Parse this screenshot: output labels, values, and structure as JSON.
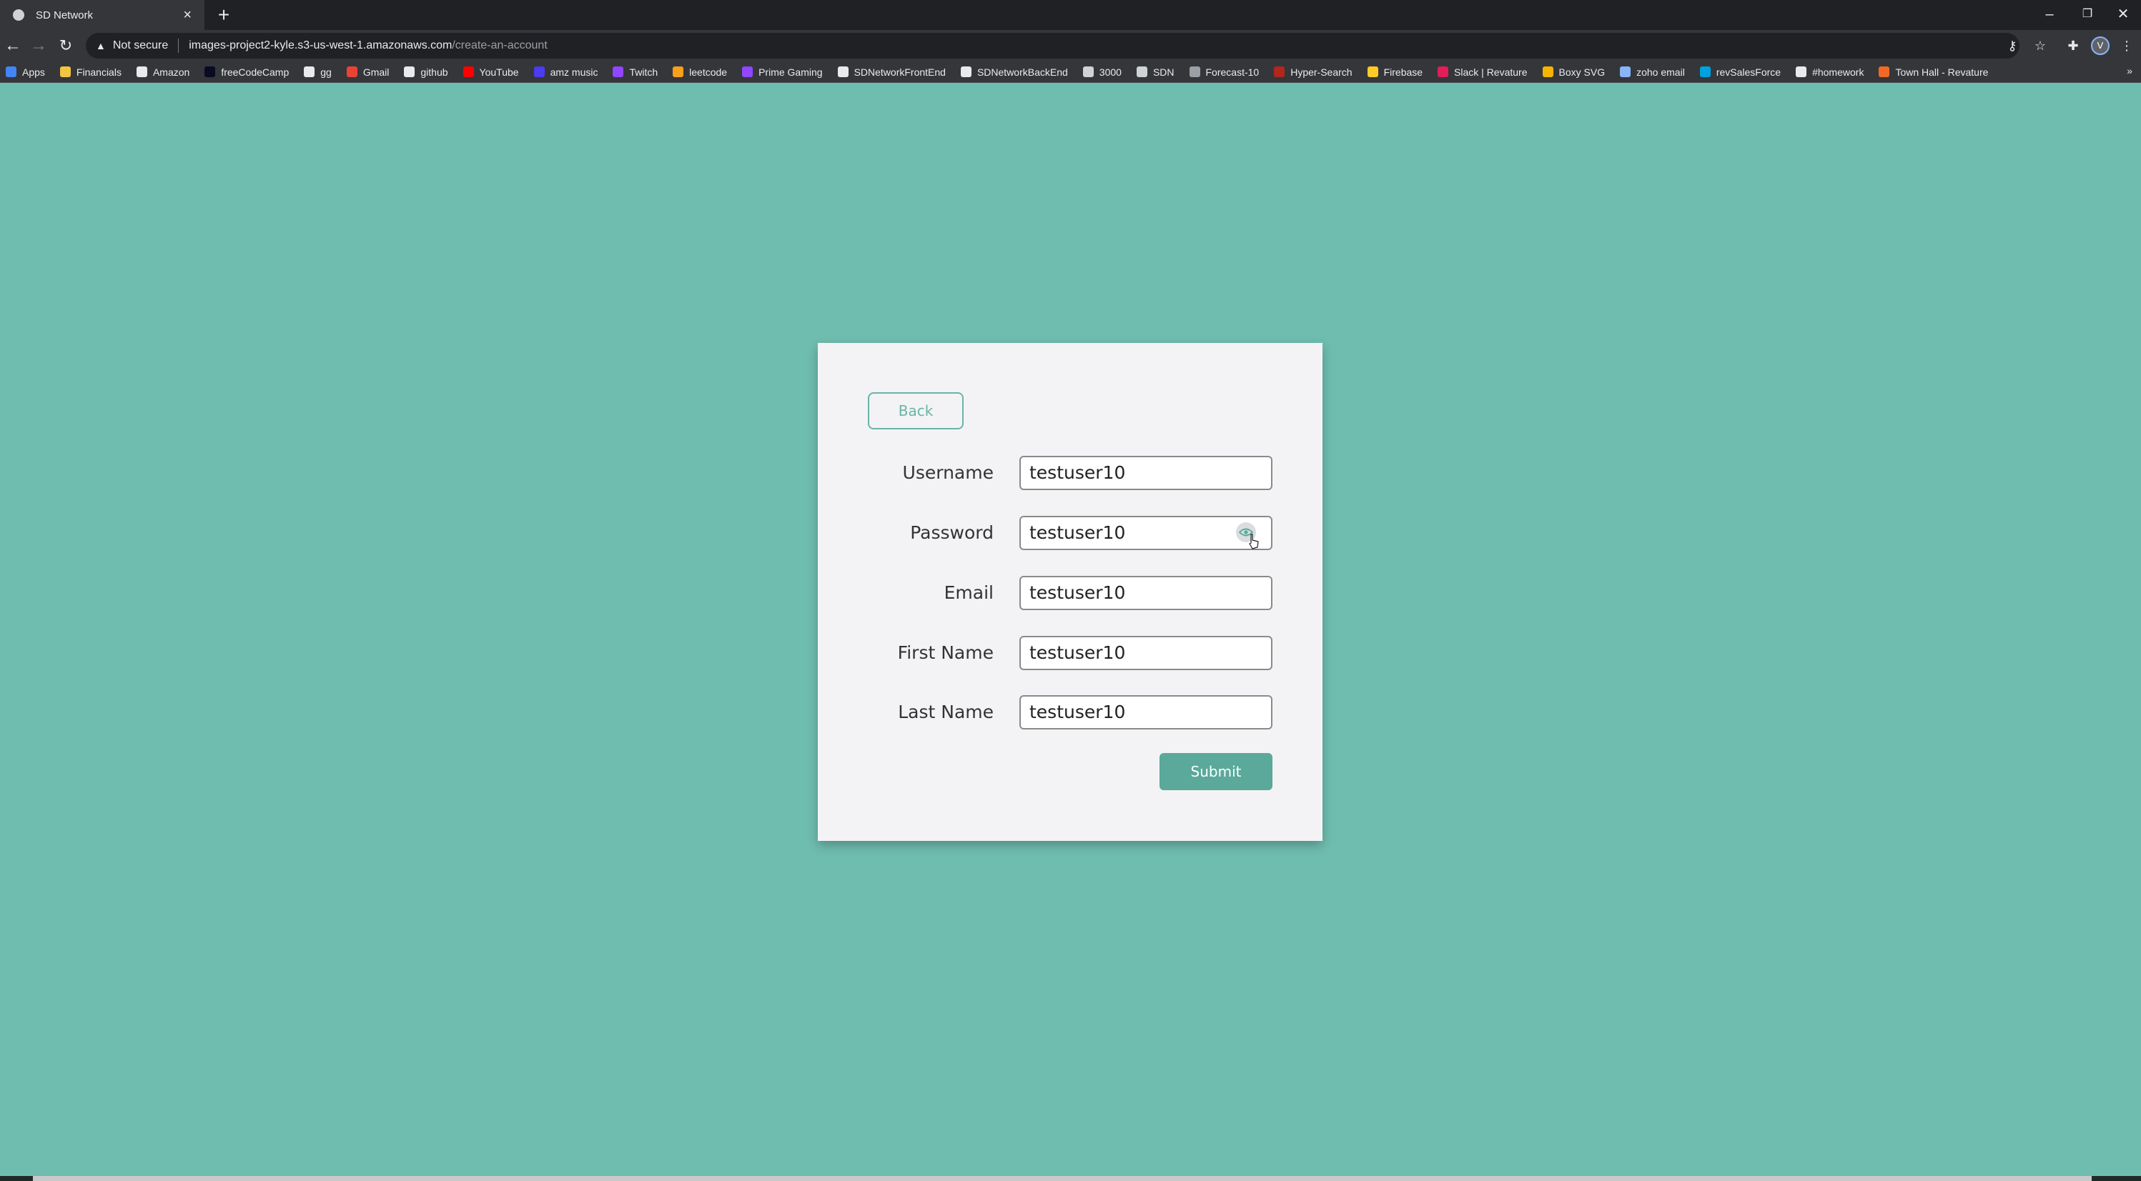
{
  "browser": {
    "tab_title": "SD Network",
    "tab_close": "×",
    "new_tab": "+",
    "window_controls": [
      "–",
      "❐",
      "✕"
    ],
    "security_text": "Not secure",
    "url_host": "images-project2-kyle.s3-us-west-1.amazonaws.com",
    "url_path": "/create-an-account",
    "profile_initial": "V",
    "bookmarks": [
      {
        "label": "Apps",
        "icon": "apps-grid-icon",
        "color": "#4285f4"
      },
      {
        "label": "Financials",
        "icon": "folder-icon",
        "color": "#f4c542"
      },
      {
        "label": "Amazon",
        "icon": "amazon-icon",
        "color": "#e8eaed"
      },
      {
        "label": "freeCodeCamp",
        "icon": "freecodecamp-icon",
        "color": "#0a0a23"
      },
      {
        "label": "gg",
        "icon": "google-icon",
        "color": "#e8eaed"
      },
      {
        "label": "Gmail",
        "icon": "gmail-icon",
        "color": "#ea4335"
      },
      {
        "label": "github",
        "icon": "github-icon",
        "color": "#e8eaed"
      },
      {
        "label": "YouTube",
        "icon": "youtube-icon",
        "color": "#ff0000"
      },
      {
        "label": "amz music",
        "icon": "amazon-music-icon",
        "color": "#4b3cf0"
      },
      {
        "label": "Twitch",
        "icon": "twitch-icon",
        "color": "#9146ff"
      },
      {
        "label": "leetcode",
        "icon": "leetcode-icon",
        "color": "#f89f1b"
      },
      {
        "label": "Prime Gaming",
        "icon": "prime-gaming-icon",
        "color": "#9146ff"
      },
      {
        "label": "SDNetworkFrontEnd",
        "icon": "github-icon",
        "color": "#e8eaed"
      },
      {
        "label": "SDNetworkBackEnd",
        "icon": "github-icon",
        "color": "#e8eaed"
      },
      {
        "label": "3000",
        "icon": "site-icon",
        "color": "#cfd3d6"
      },
      {
        "label": "SDN",
        "icon": "site-icon",
        "color": "#cfd3d6"
      },
      {
        "label": "Forecast-10",
        "icon": "forecast-icon",
        "color": "#9aa0a6"
      },
      {
        "label": "Hyper-Search",
        "icon": "hyper-icon",
        "color": "#b3261e"
      },
      {
        "label": "Firebase",
        "icon": "firebase-icon",
        "color": "#ffca28"
      },
      {
        "label": "Slack | Revature",
        "icon": "slack-icon",
        "color": "#e01e5a"
      },
      {
        "label": "Boxy SVG",
        "icon": "boxy-svg-icon",
        "color": "#f4b400"
      },
      {
        "label": "zoho email",
        "icon": "zoho-icon",
        "color": "#8ab4f8"
      },
      {
        "label": "revSalesForce",
        "icon": "salesforce-icon",
        "color": "#00a1e0"
      },
      {
        "label": "#homework",
        "icon": "homework-icon",
        "color": "#e8eaed"
      },
      {
        "label": "Town Hall - Revature",
        "icon": "revature-icon",
        "color": "#f26925"
      }
    ],
    "bookmarks_more": "»"
  },
  "form": {
    "back_label": "Back",
    "fields": [
      {
        "label": "Username",
        "value": "testuser10"
      },
      {
        "label": "Password",
        "value": "testuser10"
      },
      {
        "label": "Email",
        "value": "testuser10"
      },
      {
        "label": "First Name",
        "value": "testuser10"
      },
      {
        "label": "Last Name",
        "value": "testuser10"
      }
    ],
    "submit_label": "Submit"
  },
  "colors": {
    "page_background": "#6fbdaf",
    "card_background": "#f3f3f5",
    "accent": "#5aa99a"
  }
}
